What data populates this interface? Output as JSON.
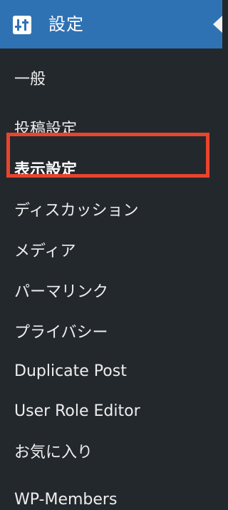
{
  "header": {
    "title": "設定",
    "icon": "settings-sliders-icon",
    "bg_color": "#2f72b3"
  },
  "menu": {
    "items": [
      {
        "label": "一般"
      },
      {
        "label": "投稿設定"
      },
      {
        "label": "表示設定",
        "current": true
      },
      {
        "label": "ディスカッション"
      },
      {
        "label": "メディア"
      },
      {
        "label": "パーマリンク"
      },
      {
        "label": "プライバシー"
      },
      {
        "label": "Duplicate Post"
      },
      {
        "label": "User Role Editor"
      },
      {
        "label": "お気に入り"
      },
      {
        "label": "WP-Members"
      }
    ]
  },
  "highlight": {
    "color": "#e8452c"
  }
}
